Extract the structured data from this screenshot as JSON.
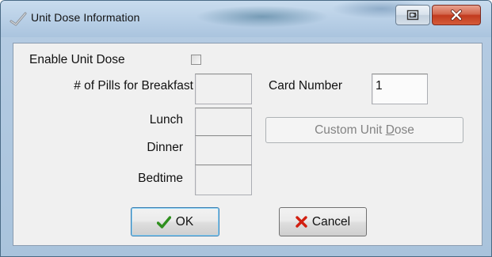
{
  "window": {
    "title": "Unit Dose Information",
    "icon": "checkmark-app-icon",
    "controls": {
      "restore": "restore-icon",
      "close": "close-icon"
    }
  },
  "form": {
    "enable_label": "Enable Unit Dose",
    "enable_checked": false,
    "breakfast_label": "# of Pills for Breakfast",
    "breakfast_value": "",
    "lunch_label": "Lunch",
    "lunch_value": "",
    "dinner_label": "Dinner",
    "dinner_value": "",
    "bedtime_label": "Bedtime",
    "bedtime_value": "",
    "card_number_label": "Card Number",
    "card_number_value": "1",
    "custom_button": {
      "before": "Custom Unit ",
      "mnemonic": "D",
      "after": "ose"
    }
  },
  "buttons": {
    "ok_label": "OK",
    "cancel_label": "Cancel",
    "ok_icon": "checkmark-icon",
    "cancel_icon": "x-icon"
  },
  "colors": {
    "ok_icon": "#2f8f1e",
    "cancel_icon": "#d21f10",
    "close_button": "#c23b1e"
  }
}
